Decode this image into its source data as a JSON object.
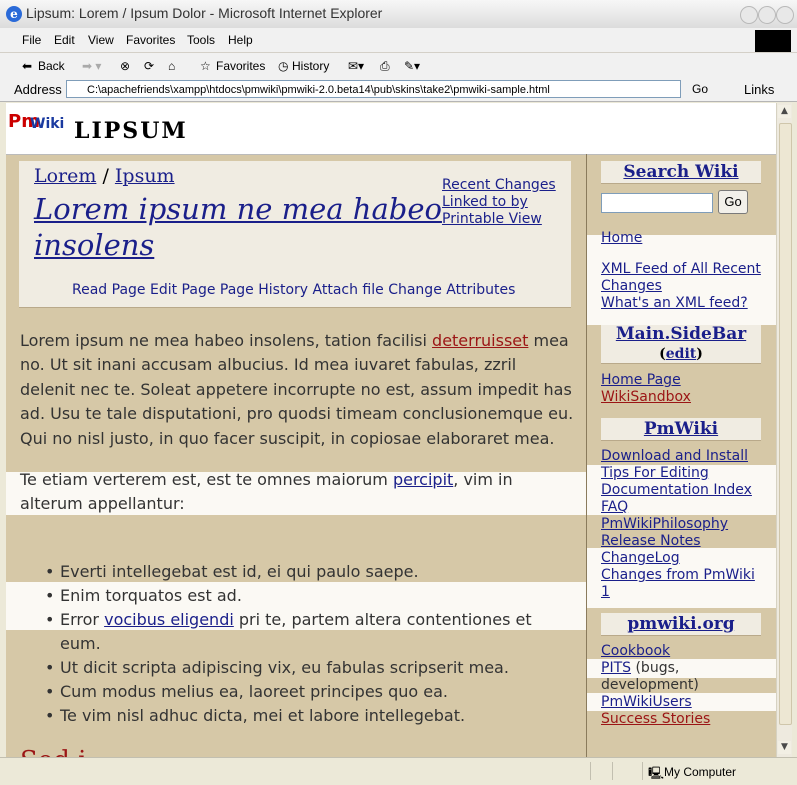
{
  "window": {
    "title": "Lipsum: Lorem / Ipsum Dolor - Microsoft Internet Explorer"
  },
  "menu": [
    "File",
    "Edit",
    "View",
    "Favorites",
    "Tools",
    "Help"
  ],
  "toolbar": {
    "back": "Back",
    "favorites": "Favorites",
    "history": "History"
  },
  "address": {
    "label": "Address",
    "url": "C:\\apachefriends\\xampp\\htdocs\\pmwiki\\pmwiki-2.0.beta14\\pub\\skins\\take2\\pmwiki-sample.html",
    "go": "Go",
    "links": "Links"
  },
  "site": {
    "logo_pm": "Pm",
    "logo_wiki": "Wiki",
    "name": "LIPSUM"
  },
  "breadcrumb": {
    "group": "Lorem",
    "sep": "/",
    "page": "Ipsum"
  },
  "page_title": "Lorem ipsum ne mea habeo insolens",
  "page_links": [
    "Recent Changes",
    "Linked to by",
    "Printable View"
  ],
  "actions": [
    "Read Page",
    "Edit Page",
    "Page History",
    "Attach file",
    "Change Attributes"
  ],
  "para1": {
    "text_a": "Lorem ipsum ne mea habeo insolens, tation facilisi ",
    "link": "deterruisset",
    "text_b": " mea no. Ut sit inani accusam albucius. Id mea iuvaret fabulas, zzril delenit nec te. Soleat appetere incorrupte no est, assum impedit has ad. Usu te tale disputationi, pro quodsi timeam conclusionemque eu. Qui no nisl justo, in quo facer suscipit, in copiosae elaboraret mea."
  },
  "para2": {
    "text_a": "Te etiam verterem est, est te omnes maiorum ",
    "link": "percipit",
    "text_b": ", vim in alterum appellantur:"
  },
  "bullets": {
    "b1": "Everti intellegebat est id, ei qui paulo saepe.",
    "b2": "Enim torquatos est ad.",
    "b3_a": "Error ",
    "b3_link": "vocibus eligendi",
    "b3_b": " pri te, partem altera contentiones et eum.",
    "b4": "Ut dicit scripta adipiscing vix, eu fabulas scripserit mea.",
    "b5": "Cum modus melius ea, laoreet principes quo ea.",
    "b6": "Te vim nisl adhuc dicta, mei et labore intellegebat."
  },
  "next_heading_partial": "Sed i",
  "sidebar": {
    "search_title": "Search Wiki",
    "go": "Go",
    "home": "Home",
    "xml_feed": "XML Feed of All Recent Changes",
    "xml_what": "What's an XML feed?",
    "main_sidebar": "Main.SideBar",
    "edit_open": "(",
    "edit": "edit",
    "edit_close": ")",
    "home_page": "Home Page",
    "wiki_sandbox": "WikiSandbox",
    "pmwiki": "PmWiki",
    "download": "Download and Install",
    "tips": "Tips For Editing",
    "docindex": "Documentation Index",
    "faq": "FAQ",
    "philosophy": "PmWikiPhilosophy",
    "release": "Release Notes",
    "changelog": "ChangeLog",
    "changes_from": "Changes from PmWiki 1",
    "pmwikiorg": "pmwiki.org",
    "cookbook": "Cookbook",
    "pits": "PITS",
    "pits_desc": " (bugs, development)",
    "users": "PmWikiUsers",
    "success": "Success Stories"
  },
  "status": {
    "zone": "My Computer"
  }
}
